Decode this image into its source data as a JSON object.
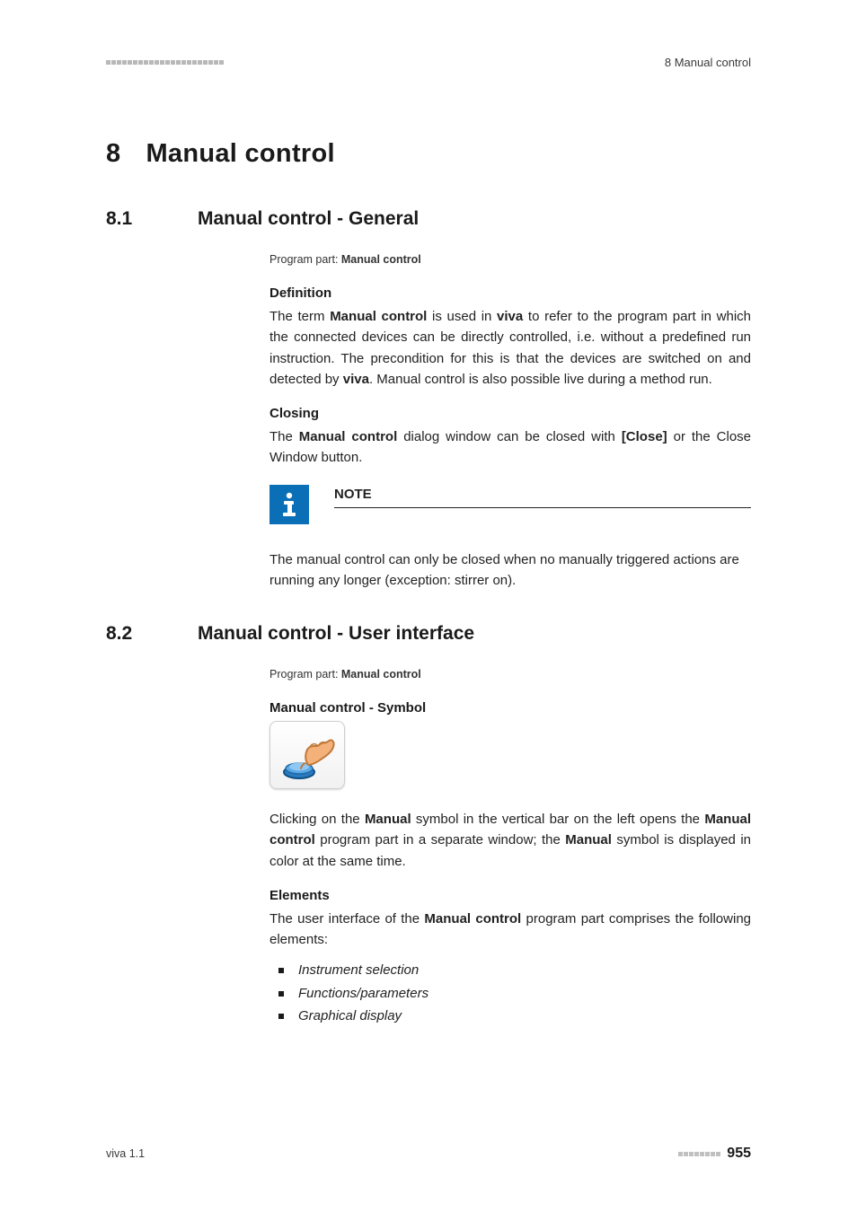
{
  "header": {
    "chapter_ref": "8 Manual control"
  },
  "chapter": {
    "number": "8",
    "title": "Manual control"
  },
  "section1": {
    "number": "8.1",
    "title": "Manual control - General",
    "program_part_label": "Program part: ",
    "program_part_value": "Manual control",
    "definition_head": "Definition",
    "definition_p1_a": "The term ",
    "definition_p1_b": "Manual control",
    "definition_p1_c": " is used in ",
    "definition_p1_d": "viva",
    "definition_p1_e": " to refer to the program part in which the connected devices can be directly controlled, i.e. without a predefined run instruction. The precondition for this is that the devices are switched on and detected by ",
    "definition_p1_f": "viva",
    "definition_p1_g": ". Manual control is also possible live during a method run.",
    "closing_head": "Closing",
    "closing_p_a": "The ",
    "closing_p_b": "Manual control",
    "closing_p_c": " dialog window can be closed with ",
    "closing_p_d": "[Close]",
    "closing_p_e": " or the Close Window button.",
    "note_title": "NOTE",
    "note_body": "The manual control can only be closed when no manually triggered actions are running any longer (exception: stirrer on)."
  },
  "section2": {
    "number": "8.2",
    "title": "Manual control - User interface",
    "program_part_label": "Program part: ",
    "program_part_value": "Manual control",
    "symbol_head": "Manual control - Symbol",
    "symbol_p_a": "Clicking on the ",
    "symbol_p_b": "Manual",
    "symbol_p_c": " symbol in the vertical bar on the left opens the ",
    "symbol_p_d": "Manual control",
    "symbol_p_e": " program part in a separate window; the ",
    "symbol_p_f": "Manual",
    "symbol_p_g": " symbol is displayed in color at the same time.",
    "elements_head": "Elements",
    "elements_p_a": "The user interface of the ",
    "elements_p_b": "Manual control",
    "elements_p_c": " program part comprises the following elements:",
    "bullets": [
      "Instrument selection",
      "Functions/parameters",
      "Graphical display"
    ]
  },
  "footer": {
    "product": "viva 1.1",
    "page_number": "955"
  }
}
